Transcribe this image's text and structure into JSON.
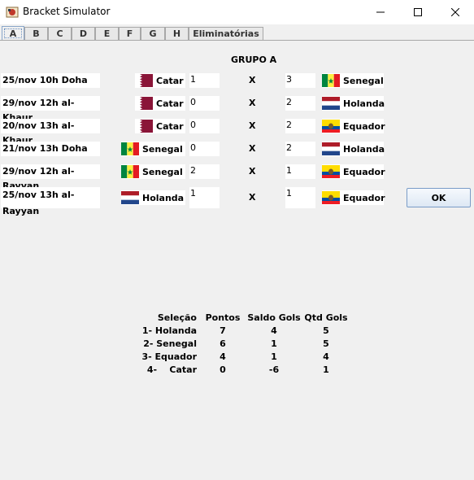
{
  "window": {
    "title": "Bracket Simulator"
  },
  "tabs": [
    "A",
    "B",
    "C",
    "D",
    "E",
    "F",
    "G",
    "H",
    "Eliminatórias"
  ],
  "group_title": "GRUPO A",
  "matches": [
    {
      "venue": "25/nov 10h Doha",
      "home": "Catar",
      "home_score": "1",
      "sep": "X",
      "away_score": "3",
      "away": "Senegal"
    },
    {
      "venue": "29/nov 12h al-Khaur",
      "home": "Catar",
      "home_score": "0",
      "sep": "X",
      "away_score": "2",
      "away": "Holanda"
    },
    {
      "venue": "20/nov 13h al-Khaur",
      "home": "Catar",
      "home_score": "0",
      "sep": "X",
      "away_score": "2",
      "away": "Equador"
    },
    {
      "venue": "21/nov 13h Doha",
      "home": "Senegal",
      "home_score": "0",
      "sep": "X",
      "away_score": "2",
      "away": "Holanda"
    },
    {
      "venue": "29/nov 12h al-Rayyan",
      "home": "Senegal",
      "home_score": "2",
      "sep": "X",
      "away_score": "1",
      "away": "Equador"
    },
    {
      "venue": "25/nov 13h al-Rayyan",
      "home": "Holanda",
      "home_score": "1",
      "sep": "X",
      "away_score": "1",
      "away": "Equador"
    }
  ],
  "ok_label": "OK",
  "standings": {
    "headers": [
      "Seleção",
      "Pontos",
      "Saldo Gols",
      "Qtd Gols"
    ],
    "rows": [
      [
        "1- Holanda",
        "7",
        "4",
        "5"
      ],
      [
        "2- Senegal",
        "6",
        "1",
        "5"
      ],
      [
        "3- Equador",
        "4",
        "1",
        "4"
      ],
      [
        "4-    Catar",
        "0",
        "-6",
        "1"
      ]
    ]
  },
  "flag_icons": {
    "Catar": "qatar-flag-icon",
    "Senegal": "senegal-flag-icon",
    "Holanda": "netherlands-flag-icon",
    "Equador": "ecuador-flag-icon"
  }
}
